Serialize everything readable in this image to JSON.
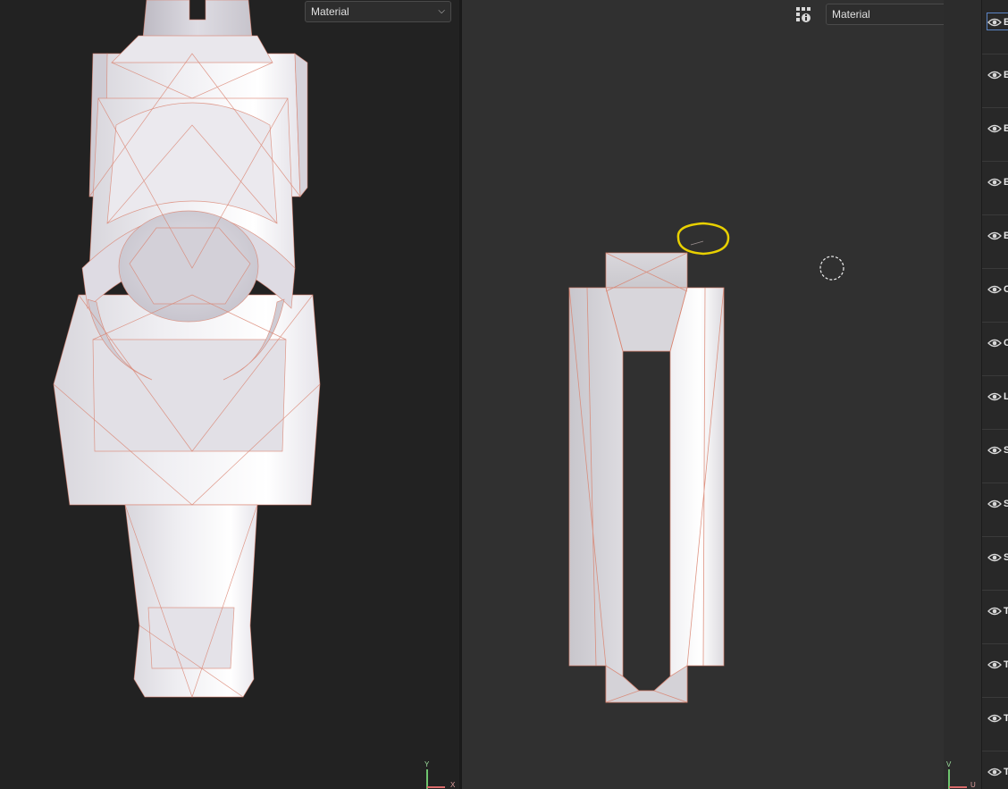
{
  "viewport3d": {
    "shading_mode": "Material",
    "gizmo": {
      "y_label": "Y",
      "x_label": "X"
    }
  },
  "viewportUV": {
    "shading_mode": "Material",
    "gizmo": {
      "v_label": "V",
      "u_label": "U"
    },
    "annotation_color": "#e8d000"
  },
  "icons": {
    "display_settings": "grid-info-icon",
    "visibility": "eye-icon",
    "dropdown": "chevron-down-icon",
    "brush_cursor": "brush-cursor-icon"
  },
  "layers": {
    "items": [
      {
        "label": "B",
        "selected": true
      },
      {
        "label": "B",
        "selected": false
      },
      {
        "label": "B",
        "selected": false
      },
      {
        "label": "B",
        "selected": false
      },
      {
        "label": "B",
        "selected": false
      },
      {
        "label": "C",
        "selected": false
      },
      {
        "label": "C",
        "selected": false
      },
      {
        "label": "L",
        "selected": false
      },
      {
        "label": "S",
        "selected": false
      },
      {
        "label": "S",
        "selected": false
      },
      {
        "label": "S",
        "selected": false
      },
      {
        "label": "T",
        "selected": false
      },
      {
        "label": "T",
        "selected": false
      },
      {
        "label": "T",
        "selected": false
      },
      {
        "label": "T",
        "selected": false
      }
    ]
  }
}
